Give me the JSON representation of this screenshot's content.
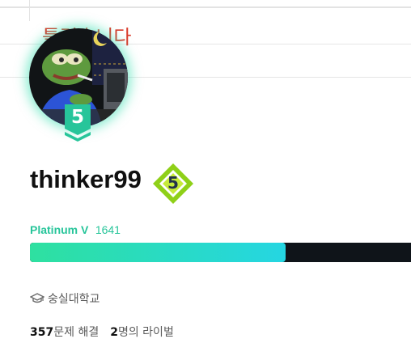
{
  "banner": {
    "text": "틀렸습니다"
  },
  "profile": {
    "username": "thinker99",
    "avatar_tier_level": "5",
    "rating_badge_level": "5",
    "tier_name": "Platinum V",
    "rating": "1641",
    "progress_fraction": 0.67,
    "school": "숭실대학교",
    "school_icon": "graduation-cap-icon",
    "solved_count": "357",
    "solved_label": "문제 해결",
    "rival_count": "2",
    "rival_label": "명의 라이벌"
  },
  "colors": {
    "tier_accent": "#27c59a",
    "progress_start": "#2ee0a0",
    "progress_end": "#25d6e2",
    "progress_track": "#0f1419",
    "rating_badge_green": "#8fd018",
    "banner_red": "#d93a2a"
  }
}
